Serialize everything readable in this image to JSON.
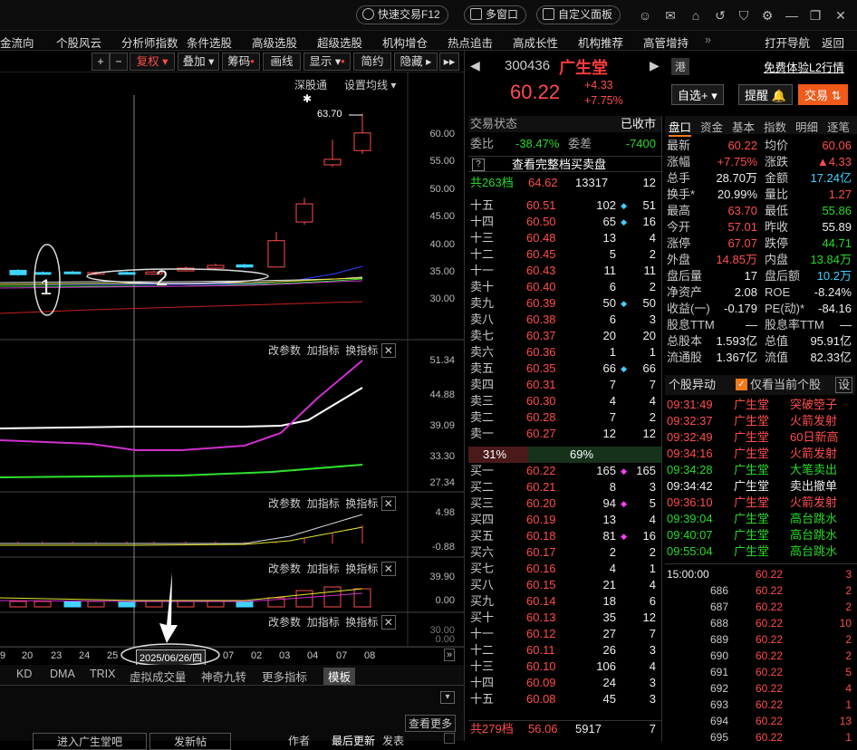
{
  "topbar": {
    "quick_trade": "快速交易F12",
    "multi_window": "多窗口",
    "custom_panel": "自定义面板"
  },
  "nav": [
    "金流向",
    "个股风云",
    "分析师指数",
    "条件选股",
    "高级选股",
    "超级选股",
    "机构增仓",
    "热点追击",
    "高成长性",
    "机构推荐",
    "高管增持",
    "打开导航",
    "返回"
  ],
  "tools": {
    "plus": "+",
    "minus": "−",
    "fuquan": "复权",
    "diejia": "叠加",
    "chouma": "筹码",
    "huaxian": "画线",
    "xianshi": "显示",
    "jianyue": "简约",
    "yincang": "隐藏"
  },
  "chart": {
    "top_links": [
      "深股通",
      "设置均线"
    ],
    "high_label": "63.70",
    "main_axis": [
      "60.00",
      "55.00",
      "50.00",
      "45.00",
      "40.00",
      "35.00",
      "30.00"
    ],
    "vol_axis": [
      "51.34",
      "44.88",
      "39.09",
      "33.30",
      "27.34"
    ],
    "macd_axis": [
      "4.98",
      "-0.88"
    ],
    "p4_axis": [
      "39.90",
      "0.00"
    ],
    "p5_axis": [
      "30.00",
      "0.00"
    ],
    "panel_tools": [
      "改参数",
      "加指标",
      "换指标"
    ],
    "annot1": "1",
    "annot2": "2",
    "candles": [
      {
        "o": 35.2,
        "c": 34.4,
        "h": 35.4,
        "l": 34.2
      },
      {
        "o": 34.8,
        "c": 34.6,
        "h": 35.0,
        "l": 34.4
      },
      {
        "o": 34.9,
        "c": 34.7,
        "h": 35.1,
        "l": 34.5
      },
      {
        "o": 34.6,
        "c": 34.8,
        "h": 35.0,
        "l": 34.5
      },
      {
        "o": 34.8,
        "c": 34.6,
        "h": 35.0,
        "l": 34.4
      },
      {
        "o": 34.5,
        "c": 34.9,
        "h": 35.2,
        "l": 34.4
      },
      {
        "o": 35.1,
        "c": 35.6,
        "h": 35.9,
        "l": 35.0
      },
      {
        "o": 35.6,
        "c": 36.1,
        "h": 36.4,
        "l": 35.4
      },
      {
        "o": 36.2,
        "c": 35.8,
        "h": 36.4,
        "l": 35.6
      },
      {
        "o": 35.8,
        "c": 40.6,
        "h": 42.2,
        "l": 35.7
      },
      {
        "o": 44.0,
        "c": 47.3,
        "h": 48.4,
        "l": 43.5
      },
      {
        "o": 54.4,
        "c": 55.4,
        "h": 59.0,
        "l": 54.0
      },
      {
        "o": 57.0,
        "c": 60.2,
        "h": 63.7,
        "l": 56.4
      }
    ]
  },
  "xaxis": {
    "ticks": [
      "9",
      "20",
      "23",
      "24",
      "25",
      "07",
      "02",
      "03",
      "04",
      "07",
      "08"
    ],
    "selected": "2025/06/26/四"
  },
  "itabs": [
    "KD",
    "DMA",
    "TRIX",
    "虚拟成交量",
    "神奇九转",
    "更多指标",
    "模板"
  ],
  "bottom": {
    "more": "查看更多",
    "enter": "进入广生堂吧",
    "post": "发新帖",
    "author": "作者",
    "latest": "最后更新",
    "publish": "发表"
  },
  "stock": {
    "code": "300436",
    "name": "广生堂",
    "price": "60.22",
    "chg": "+4.33",
    "pct": "+7.75%",
    "gang": "港",
    "free": "免费体验L2行情",
    "zixuan": "自选+",
    "tixing": "提醒",
    "jiaoyi": "交易"
  },
  "ob_head": {
    "status_label": "交易状态",
    "status": "已收市",
    "weibi_label": "委比",
    "weibi": "-38.47%",
    "weicha_label": "委差",
    "weicha": "-7400",
    "full": "查看完整档买卖盘",
    "sell_total_label": "共263档",
    "sell_total_price": "64.62",
    "sell_total_vol": "13317",
    "sell_total_n": "12",
    "buy_total_label": "共279档",
    "buy_total_price": "56.06",
    "buy_total_vol": "5917",
    "buy_total_n": "7",
    "ratio_sell": "31%",
    "ratio_buy": "69%"
  },
  "sell": [
    {
      "l": "十五",
      "p": "60.51",
      "v": "102",
      "n": "51",
      "m": "c"
    },
    {
      "l": "十四",
      "p": "60.50",
      "v": "65",
      "n": "16",
      "m": "c"
    },
    {
      "l": "十三",
      "p": "60.48",
      "v": "13",
      "n": "4",
      "m": ""
    },
    {
      "l": "十二",
      "p": "60.45",
      "v": "5",
      "n": "2",
      "m": ""
    },
    {
      "l": "十一",
      "p": "60.43",
      "v": "11",
      "n": "11",
      "m": ""
    },
    {
      "l": "卖十",
      "p": "60.40",
      "v": "6",
      "n": "2",
      "m": ""
    },
    {
      "l": "卖九",
      "p": "60.39",
      "v": "50",
      "n": "50",
      "m": "c"
    },
    {
      "l": "卖八",
      "p": "60.38",
      "v": "6",
      "n": "3",
      "m": ""
    },
    {
      "l": "卖七",
      "p": "60.37",
      "v": "20",
      "n": "20",
      "m": ""
    },
    {
      "l": "卖六",
      "p": "60.36",
      "v": "1",
      "n": "1",
      "m": ""
    },
    {
      "l": "卖五",
      "p": "60.35",
      "v": "66",
      "n": "66",
      "m": "c"
    },
    {
      "l": "卖四",
      "p": "60.31",
      "v": "7",
      "n": "7",
      "m": ""
    },
    {
      "l": "卖三",
      "p": "60.30",
      "v": "4",
      "n": "4",
      "m": ""
    },
    {
      "l": "卖二",
      "p": "60.28",
      "v": "7",
      "n": "2",
      "m": ""
    },
    {
      "l": "卖一",
      "p": "60.27",
      "v": "12",
      "n": "12",
      "m": ""
    }
  ],
  "buy": [
    {
      "l": "买一",
      "p": "60.22",
      "v": "165",
      "n": "165",
      "m": "m"
    },
    {
      "l": "买二",
      "p": "60.21",
      "v": "8",
      "n": "3",
      "m": ""
    },
    {
      "l": "买三",
      "p": "60.20",
      "v": "94",
      "n": "5",
      "m": "m"
    },
    {
      "l": "买四",
      "p": "60.19",
      "v": "13",
      "n": "4",
      "m": ""
    },
    {
      "l": "买五",
      "p": "60.18",
      "v": "81",
      "n": "16",
      "m": "m"
    },
    {
      "l": "买六",
      "p": "60.17",
      "v": "2",
      "n": "2",
      "m": ""
    },
    {
      "l": "买七",
      "p": "60.16",
      "v": "4",
      "n": "1",
      "m": ""
    },
    {
      "l": "买八",
      "p": "60.15",
      "v": "21",
      "n": "4",
      "m": ""
    },
    {
      "l": "买九",
      "p": "60.14",
      "v": "18",
      "n": "6",
      "m": ""
    },
    {
      "l": "买十",
      "p": "60.13",
      "v": "35",
      "n": "12",
      "m": ""
    },
    {
      "l": "十一",
      "p": "60.12",
      "v": "27",
      "n": "7",
      "m": ""
    },
    {
      "l": "十二",
      "p": "60.11",
      "v": "26",
      "n": "3",
      "m": ""
    },
    {
      "l": "十三",
      "p": "60.10",
      "v": "106",
      "n": "4",
      "m": ""
    },
    {
      "l": "十四",
      "p": "60.09",
      "v": "24",
      "n": "3",
      "m": ""
    },
    {
      "l": "十五",
      "p": "60.08",
      "v": "45",
      "n": "3",
      "m": ""
    }
  ],
  "qtabs": [
    "盘口",
    "资金",
    "基本",
    "指数",
    "明细",
    "逐笔"
  ],
  "quote": [
    [
      "最新",
      "60.22",
      "r",
      "均价",
      "60.06",
      "r"
    ],
    [
      "涨幅",
      "+7.75%",
      "r",
      "涨跌",
      "▲4.33",
      "r"
    ],
    [
      "总手",
      "28.70万",
      "w",
      "金额",
      "17.24亿",
      "c"
    ],
    [
      "换手*",
      "20.99%",
      "w",
      "量比",
      "1.27",
      "r"
    ],
    [
      "最高",
      "63.70",
      "r",
      "最低",
      "55.86",
      "g"
    ],
    [
      "今开",
      "57.01",
      "r",
      "昨收",
      "55.89",
      "w"
    ],
    [
      "涨停",
      "67.07",
      "r",
      "跌停",
      "44.71",
      "g"
    ],
    [
      "外盘",
      "14.85万",
      "r",
      "内盘",
      "13.84万",
      "g"
    ],
    [
      "盘后量",
      "17",
      "w",
      "盘后额",
      "10.2万",
      "c"
    ],
    [
      "净资产",
      "2.08",
      "w",
      "ROE",
      "-8.24%",
      "w"
    ],
    [
      "收益(一)",
      "-0.179",
      "w",
      "PE(动)*",
      "-84.16",
      "w"
    ],
    [
      "股息TTM",
      "—",
      "w",
      "股息率TTM",
      "—",
      "w"
    ],
    [
      "总股本",
      "1.593亿",
      "w",
      "总值",
      "95.91亿",
      "w"
    ],
    [
      "流通股",
      "1.367亿",
      "w",
      "流值",
      "82.33亿",
      "w"
    ]
  ],
  "alerts_head": {
    "title": "个股异动",
    "only": "仅看当前个股",
    "set": "设"
  },
  "alerts": [
    [
      "09:31:49",
      "广生堂",
      "突破箜子",
      "r"
    ],
    [
      "09:32:37",
      "广生堂",
      "火箭发射",
      "r"
    ],
    [
      "09:32:49",
      "广生堂",
      "60日新高",
      "r"
    ],
    [
      "09:34:16",
      "广生堂",
      "火箭发射",
      "r"
    ],
    [
      "09:34:28",
      "广生堂",
      "大笔卖出",
      "g"
    ],
    [
      "09:34:42",
      "广生堂",
      "卖出撤单",
      "w"
    ],
    [
      "09:36:10",
      "广生堂",
      "火箭发射",
      "r"
    ],
    [
      "09:39:04",
      "广生堂",
      "高台跳水",
      "g"
    ],
    [
      "09:40:07",
      "广生堂",
      "高台跳水",
      "g"
    ],
    [
      "09:55:04",
      "广生堂",
      "高台跳水",
      "g"
    ]
  ],
  "ticks": [
    [
      "15:00:00",
      "60.22",
      "3"
    ],
    [
      "686",
      "60.22",
      "2"
    ],
    [
      "687",
      "60.22",
      "2"
    ],
    [
      "688",
      "60.22",
      "10"
    ],
    [
      "689",
      "60.22",
      "2"
    ],
    [
      "690",
      "60.22",
      "2"
    ],
    [
      "691",
      "60.22",
      "5"
    ],
    [
      "692",
      "60.22",
      "4"
    ],
    [
      "693",
      "60.22",
      "1"
    ],
    [
      "694",
      "60.22",
      "13"
    ],
    [
      "695",
      "60.22",
      "1"
    ]
  ]
}
